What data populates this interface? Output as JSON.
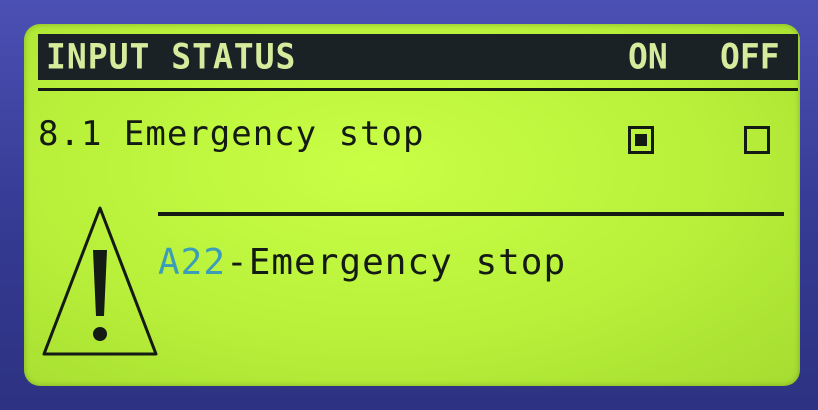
{
  "header": {
    "title": "INPUT STATUS",
    "col_on": "ON",
    "col_off": "OFF"
  },
  "inputs": [
    {
      "label": "8.1 Emergency stop",
      "on_checked": true,
      "off_checked": false
    }
  ],
  "alarm": {
    "code": "A22",
    "text": "-Emergency stop",
    "icon": "warning-triangle-icon"
  },
  "colors": {
    "lcd_background": "#b8f03a",
    "header_background": "#1a2226",
    "alarm_code": "#3b9db8",
    "bezel": "#3a3f9e"
  }
}
